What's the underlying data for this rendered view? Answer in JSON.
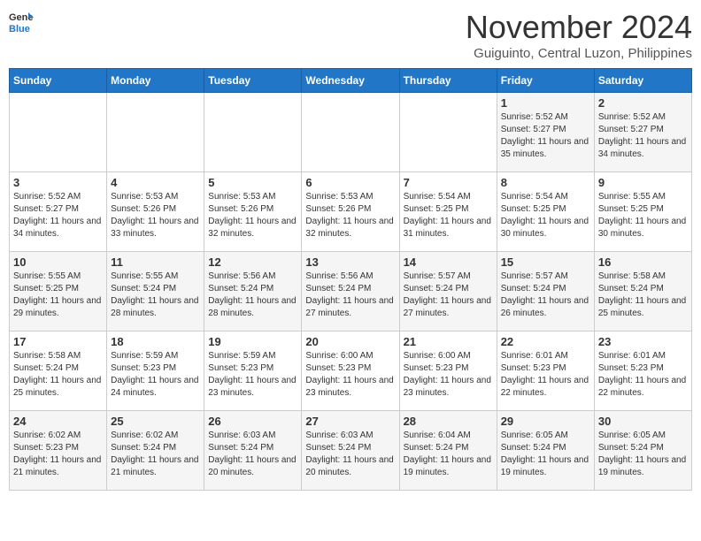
{
  "header": {
    "logo_general": "General",
    "logo_blue": "Blue",
    "month": "November 2024",
    "location": "Guiguinto, Central Luzon, Philippines"
  },
  "days_of_week": [
    "Sunday",
    "Monday",
    "Tuesday",
    "Wednesday",
    "Thursday",
    "Friday",
    "Saturday"
  ],
  "weeks": [
    [
      {
        "num": "",
        "sunrise": "",
        "sunset": "",
        "daylight": ""
      },
      {
        "num": "",
        "sunrise": "",
        "sunset": "",
        "daylight": ""
      },
      {
        "num": "",
        "sunrise": "",
        "sunset": "",
        "daylight": ""
      },
      {
        "num": "",
        "sunrise": "",
        "sunset": "",
        "daylight": ""
      },
      {
        "num": "",
        "sunrise": "",
        "sunset": "",
        "daylight": ""
      },
      {
        "num": "1",
        "sunrise": "Sunrise: 5:52 AM",
        "sunset": "Sunset: 5:27 PM",
        "daylight": "Daylight: 11 hours and 35 minutes."
      },
      {
        "num": "2",
        "sunrise": "Sunrise: 5:52 AM",
        "sunset": "Sunset: 5:27 PM",
        "daylight": "Daylight: 11 hours and 34 minutes."
      }
    ],
    [
      {
        "num": "3",
        "sunrise": "Sunrise: 5:52 AM",
        "sunset": "Sunset: 5:27 PM",
        "daylight": "Daylight: 11 hours and 34 minutes."
      },
      {
        "num": "4",
        "sunrise": "Sunrise: 5:53 AM",
        "sunset": "Sunset: 5:26 PM",
        "daylight": "Daylight: 11 hours and 33 minutes."
      },
      {
        "num": "5",
        "sunrise": "Sunrise: 5:53 AM",
        "sunset": "Sunset: 5:26 PM",
        "daylight": "Daylight: 11 hours and 32 minutes."
      },
      {
        "num": "6",
        "sunrise": "Sunrise: 5:53 AM",
        "sunset": "Sunset: 5:26 PM",
        "daylight": "Daylight: 11 hours and 32 minutes."
      },
      {
        "num": "7",
        "sunrise": "Sunrise: 5:54 AM",
        "sunset": "Sunset: 5:25 PM",
        "daylight": "Daylight: 11 hours and 31 minutes."
      },
      {
        "num": "8",
        "sunrise": "Sunrise: 5:54 AM",
        "sunset": "Sunset: 5:25 PM",
        "daylight": "Daylight: 11 hours and 30 minutes."
      },
      {
        "num": "9",
        "sunrise": "Sunrise: 5:55 AM",
        "sunset": "Sunset: 5:25 PM",
        "daylight": "Daylight: 11 hours and 30 minutes."
      }
    ],
    [
      {
        "num": "10",
        "sunrise": "Sunrise: 5:55 AM",
        "sunset": "Sunset: 5:25 PM",
        "daylight": "Daylight: 11 hours and 29 minutes."
      },
      {
        "num": "11",
        "sunrise": "Sunrise: 5:55 AM",
        "sunset": "Sunset: 5:24 PM",
        "daylight": "Daylight: 11 hours and 28 minutes."
      },
      {
        "num": "12",
        "sunrise": "Sunrise: 5:56 AM",
        "sunset": "Sunset: 5:24 PM",
        "daylight": "Daylight: 11 hours and 28 minutes."
      },
      {
        "num": "13",
        "sunrise": "Sunrise: 5:56 AM",
        "sunset": "Sunset: 5:24 PM",
        "daylight": "Daylight: 11 hours and 27 minutes."
      },
      {
        "num": "14",
        "sunrise": "Sunrise: 5:57 AM",
        "sunset": "Sunset: 5:24 PM",
        "daylight": "Daylight: 11 hours and 27 minutes."
      },
      {
        "num": "15",
        "sunrise": "Sunrise: 5:57 AM",
        "sunset": "Sunset: 5:24 PM",
        "daylight": "Daylight: 11 hours and 26 minutes."
      },
      {
        "num": "16",
        "sunrise": "Sunrise: 5:58 AM",
        "sunset": "Sunset: 5:24 PM",
        "daylight": "Daylight: 11 hours and 25 minutes."
      }
    ],
    [
      {
        "num": "17",
        "sunrise": "Sunrise: 5:58 AM",
        "sunset": "Sunset: 5:24 PM",
        "daylight": "Daylight: 11 hours and 25 minutes."
      },
      {
        "num": "18",
        "sunrise": "Sunrise: 5:59 AM",
        "sunset": "Sunset: 5:23 PM",
        "daylight": "Daylight: 11 hours and 24 minutes."
      },
      {
        "num": "19",
        "sunrise": "Sunrise: 5:59 AM",
        "sunset": "Sunset: 5:23 PM",
        "daylight": "Daylight: 11 hours and 23 minutes."
      },
      {
        "num": "20",
        "sunrise": "Sunrise: 6:00 AM",
        "sunset": "Sunset: 5:23 PM",
        "daylight": "Daylight: 11 hours and 23 minutes."
      },
      {
        "num": "21",
        "sunrise": "Sunrise: 6:00 AM",
        "sunset": "Sunset: 5:23 PM",
        "daylight": "Daylight: 11 hours and 23 minutes."
      },
      {
        "num": "22",
        "sunrise": "Sunrise: 6:01 AM",
        "sunset": "Sunset: 5:23 PM",
        "daylight": "Daylight: 11 hours and 22 minutes."
      },
      {
        "num": "23",
        "sunrise": "Sunrise: 6:01 AM",
        "sunset": "Sunset: 5:23 PM",
        "daylight": "Daylight: 11 hours and 22 minutes."
      }
    ],
    [
      {
        "num": "24",
        "sunrise": "Sunrise: 6:02 AM",
        "sunset": "Sunset: 5:23 PM",
        "daylight": "Daylight: 11 hours and 21 minutes."
      },
      {
        "num": "25",
        "sunrise": "Sunrise: 6:02 AM",
        "sunset": "Sunset: 5:24 PM",
        "daylight": "Daylight: 11 hours and 21 minutes."
      },
      {
        "num": "26",
        "sunrise": "Sunrise: 6:03 AM",
        "sunset": "Sunset: 5:24 PM",
        "daylight": "Daylight: 11 hours and 20 minutes."
      },
      {
        "num": "27",
        "sunrise": "Sunrise: 6:03 AM",
        "sunset": "Sunset: 5:24 PM",
        "daylight": "Daylight: 11 hours and 20 minutes."
      },
      {
        "num": "28",
        "sunrise": "Sunrise: 6:04 AM",
        "sunset": "Sunset: 5:24 PM",
        "daylight": "Daylight: 11 hours and 19 minutes."
      },
      {
        "num": "29",
        "sunrise": "Sunrise: 6:05 AM",
        "sunset": "Sunset: 5:24 PM",
        "daylight": "Daylight: 11 hours and 19 minutes."
      },
      {
        "num": "30",
        "sunrise": "Sunrise: 6:05 AM",
        "sunset": "Sunset: 5:24 PM",
        "daylight": "Daylight: 11 hours and 19 minutes."
      }
    ]
  ]
}
